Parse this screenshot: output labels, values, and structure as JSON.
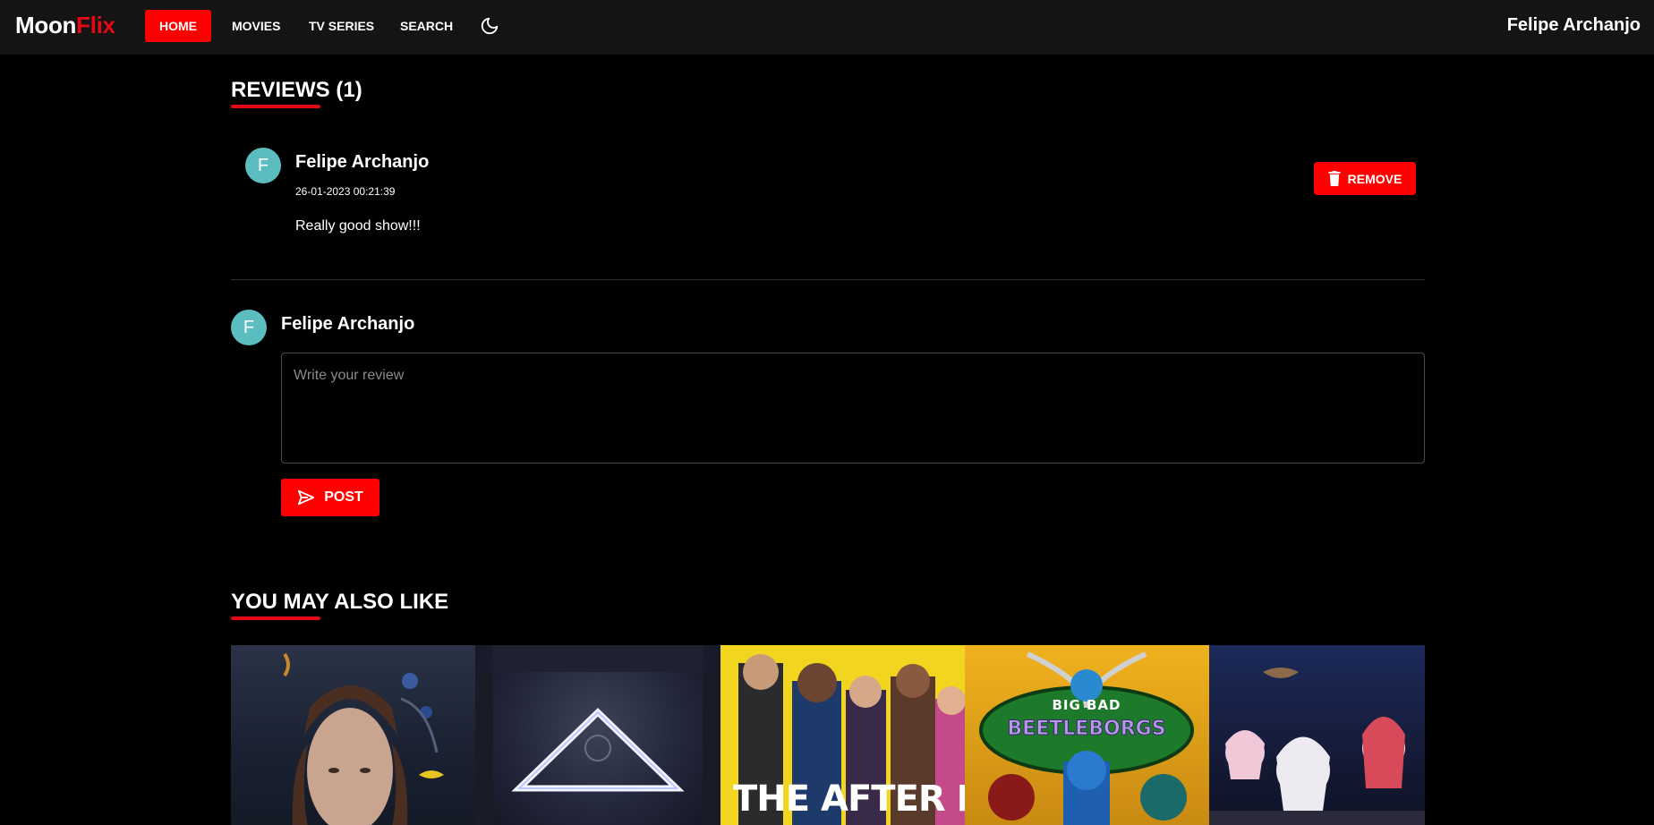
{
  "nav": {
    "logo_part1": "Moon",
    "logo_part2": "Flix",
    "items": [
      {
        "label": "HOME",
        "active": true
      },
      {
        "label": "MOVIES"
      },
      {
        "label": "TV SERIES"
      },
      {
        "label": "SEARCH"
      }
    ],
    "theme_icon": "moon-icon",
    "user_name": "Felipe Archanjo"
  },
  "reviews": {
    "title": "REVIEWS (1)",
    "items": [
      {
        "avatar_letter": "F",
        "author": "Felipe Archanjo",
        "date": "26-01-2023 00:21:39",
        "text": "Really good show!!!",
        "remove_label": "REMOVE",
        "remove_icon": "trash-icon"
      }
    ]
  },
  "compose": {
    "avatar_letter": "F",
    "author": "Felipe Archanjo",
    "placeholder": "Write your review",
    "value": "",
    "post_label": "POST",
    "post_icon": "send-icon"
  },
  "recommendations": {
    "title": "YOU MAY ALSO LIKE",
    "posters": [
      {
        "name": "poster-1",
        "color": "#1a2233"
      },
      {
        "name": "poster-2",
        "color": "#272a38"
      },
      {
        "name": "poster-the-afterparty",
        "title_text": "THE AFTER PARTY",
        "color": "#f2d51f"
      },
      {
        "name": "poster-big-bad-beetleborgs",
        "title_text": "BIG BAD BEETLEBORGS",
        "color": "#d4a01a"
      },
      {
        "name": "poster-5",
        "color": "#1c2444"
      }
    ]
  },
  "colors": {
    "accent": "#e50914",
    "button_red": "#ff0000",
    "avatar": "#5bbdc0",
    "navbar_bg": "#141414",
    "page_bg": "#000000"
  }
}
